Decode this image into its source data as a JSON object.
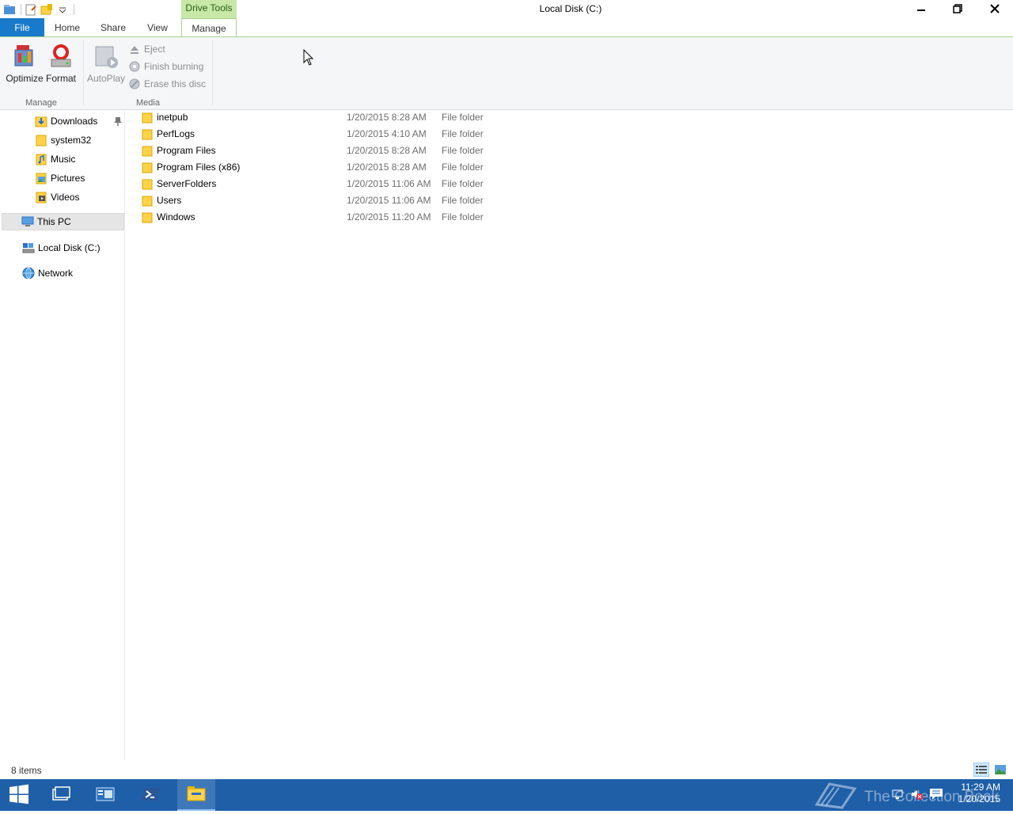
{
  "window": {
    "title": "Local Disk (C:)",
    "context_tab_header": "Drive Tools"
  },
  "ribbon_tabs": {
    "file": "File",
    "home": "Home",
    "share": "Share",
    "view": "View",
    "manage": "Manage"
  },
  "ribbon": {
    "manage_group": {
      "label": "Manage",
      "optimize": "Optimize",
      "format": "Format"
    },
    "media_group": {
      "label": "Media",
      "autoplay": "AutoPlay",
      "eject": "Eject",
      "finish_burning": "Finish burning",
      "erase_disc": "Erase this disc"
    }
  },
  "nav": {
    "quick_access": [
      "Downloads",
      "system32",
      "Music",
      "Pictures",
      "Videos"
    ],
    "this_pc": "This PC",
    "local_disk": "Local Disk (C:)",
    "network": "Network"
  },
  "files": [
    {
      "name": "inetpub",
      "date": "1/20/2015 8:28 AM",
      "type": "File folder"
    },
    {
      "name": "PerfLogs",
      "date": "1/20/2015 4:10 AM",
      "type": "File folder"
    },
    {
      "name": "Program Files",
      "date": "1/20/2015 8:28 AM",
      "type": "File folder"
    },
    {
      "name": "Program Files (x86)",
      "date": "1/20/2015 8:28 AM",
      "type": "File folder"
    },
    {
      "name": "ServerFolders",
      "date": "1/20/2015 11:06 AM",
      "type": "File folder"
    },
    {
      "name": "Users",
      "date": "1/20/2015 11:06 AM",
      "type": "File folder"
    },
    {
      "name": "Windows",
      "date": "1/20/2015 11:20 AM",
      "type": "File folder"
    }
  ],
  "status": {
    "items_count": "8 items"
  },
  "taskbar": {
    "watermark": "The Collection Book",
    "time": "11:29 AM",
    "date": "1/20/2015"
  },
  "colors": {
    "accent": "#1979ca",
    "context_tab": "#c7e8a7",
    "taskbar": "#1f5fa8",
    "folder": "#ffd24a"
  }
}
